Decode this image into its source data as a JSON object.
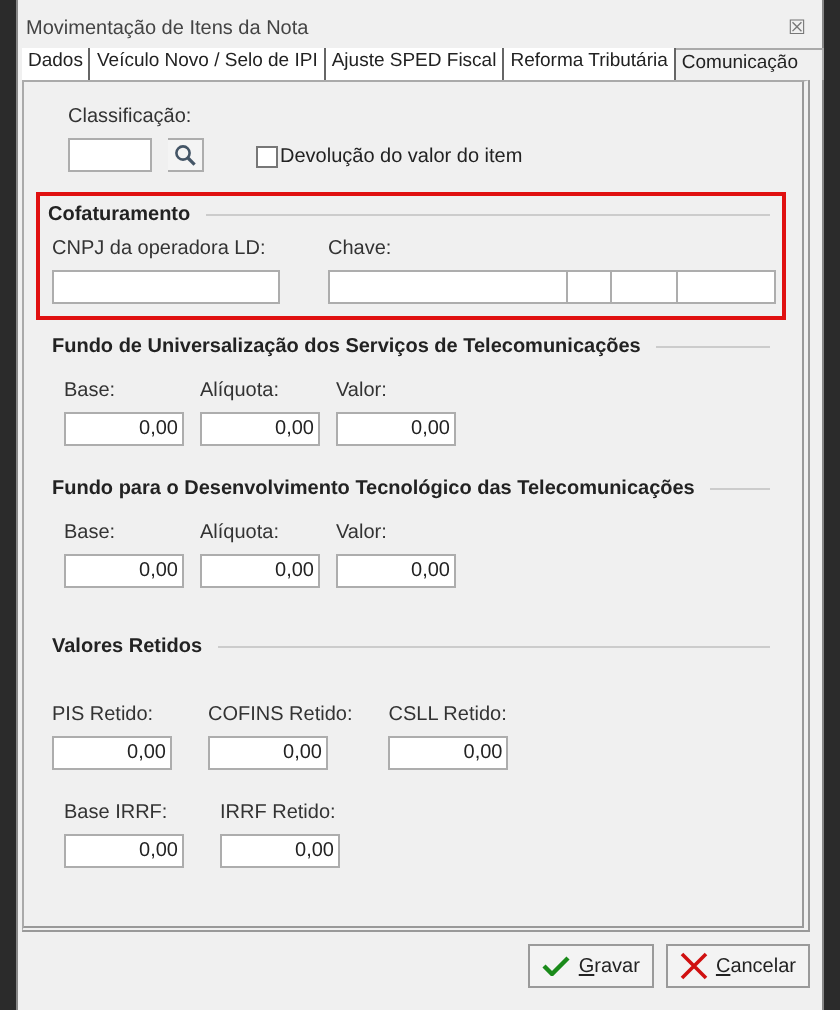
{
  "window": {
    "title": "Movimentação de Itens da Nota",
    "close": "☒"
  },
  "tabs": [
    {
      "label": "Dados",
      "selected": false
    },
    {
      "label": "Veículo Novo / Selo de IPI",
      "selected": false
    },
    {
      "label": "Ajuste SPED Fiscal",
      "selected": false
    },
    {
      "label": "Reforma Tributária",
      "selected": false
    },
    {
      "label": "Comunicação",
      "selected": true
    }
  ],
  "classificacao": {
    "label": "Classificação:",
    "checkbox": {
      "label": "Devolução do valor do item",
      "checked": false
    }
  },
  "cofaturamento": {
    "title": "Cofaturamento",
    "highlighted": true,
    "cnpj_label": "CNPJ da operadora LD:",
    "chave_label": "Chave:"
  },
  "sections": [
    {
      "title": "Fundo de Universalização dos Serviços de Telecomunicações",
      "rows": [
        [
          {
            "label": "Base:",
            "value": "0,00"
          },
          {
            "label": "Alíquota:",
            "value": "0,00"
          },
          {
            "label": "Valor:",
            "value": "0,00"
          }
        ]
      ]
    },
    {
      "title": "Fundo para o Desenvolvimento Tecnológico das Telecomunicações",
      "rows": [
        [
          {
            "label": "Base:",
            "value": "0,00"
          },
          {
            "label": "Alíquota:",
            "value": "0,00"
          },
          {
            "label": "Valor:",
            "value": "0,00"
          }
        ]
      ]
    },
    {
      "title": "Valores Retidos",
      "rows": [
        [
          {
            "label": "PIS Retido:",
            "value": "0,00"
          },
          {
            "label": "COFINS Retido:",
            "value": "0,00"
          },
          {
            "label": "CSLL Retido:",
            "value": "0,00"
          }
        ],
        [
          {
            "label": "Base IRRF:",
            "value": "0,00"
          },
          {
            "label": "IRRF Retido:",
            "value": "0,00"
          }
        ]
      ]
    }
  ],
  "buttons": [
    {
      "label": "Gravar",
      "kind": "ok"
    },
    {
      "label": "Cancelar",
      "kind": "cancel"
    }
  ]
}
